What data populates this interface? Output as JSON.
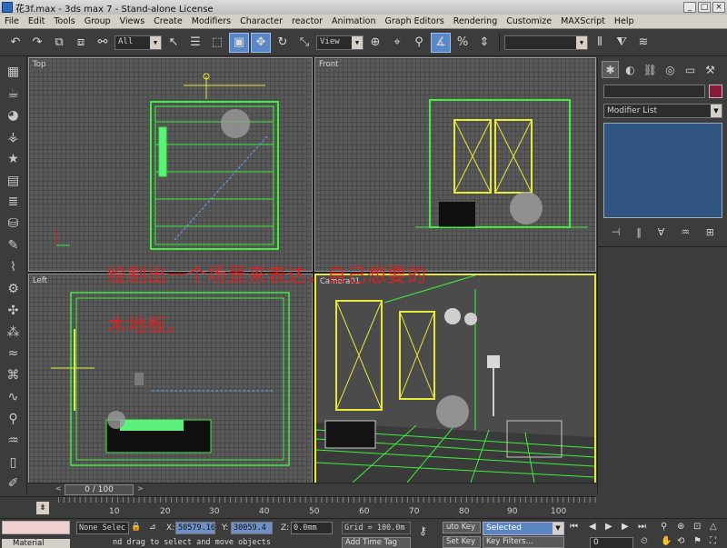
{
  "window": {
    "title": "花3f.max - 3ds max 7 - Stand-alone License",
    "buttons": [
      "_",
      "□",
      "×"
    ]
  },
  "menu": [
    "File",
    "Edit",
    "Tools",
    "Group",
    "Views",
    "Create",
    "Modifiers",
    "Character",
    "reactor",
    "Animation",
    "Graph Editors",
    "Rendering",
    "Customize",
    "MAXScript",
    "Help"
  ],
  "toolbar": {
    "selection_filter": "All",
    "reference_coord": "View"
  },
  "viewports": {
    "top_label": "Top",
    "front_label": "Front",
    "left_label": "Left",
    "camera_label": "Camera01"
  },
  "annotation": {
    "line1": "绘制出一个场景来表达，自己想要的",
    "line2": "木地板。"
  },
  "command_panel": {
    "modifier_list": "Modifier List"
  },
  "time_slider": {
    "position": "0 / 100",
    "prev": "<",
    "next": ">"
  },
  "trackbar": {
    "ticks": [
      "10",
      "20",
      "30",
      "40",
      "50",
      "60",
      "70",
      "80",
      "90",
      "100"
    ]
  },
  "status": {
    "selection": "None Selec",
    "x_label": "X:",
    "x_value": "50579.16",
    "y_label": "Y:",
    "y_value": "30059.4",
    "z_label": "Z:",
    "z_value": "0.0mm",
    "grid": "Grid = 100.0m",
    "prompt": "nd drag to select and move objects",
    "add_time_tag": "Add Time Tag",
    "auto_key": "uto Key",
    "selected": "Selected",
    "set_key": "Set Key",
    "key_filters": "Key Filters...",
    "frame": "0",
    "material_tab": "Material"
  },
  "colors": {
    "wireframe_green": "#3cf03c",
    "selected_yellow": "#e8e83a",
    "annotation_red": "#e02020",
    "active_blue": "#5a88c6"
  }
}
